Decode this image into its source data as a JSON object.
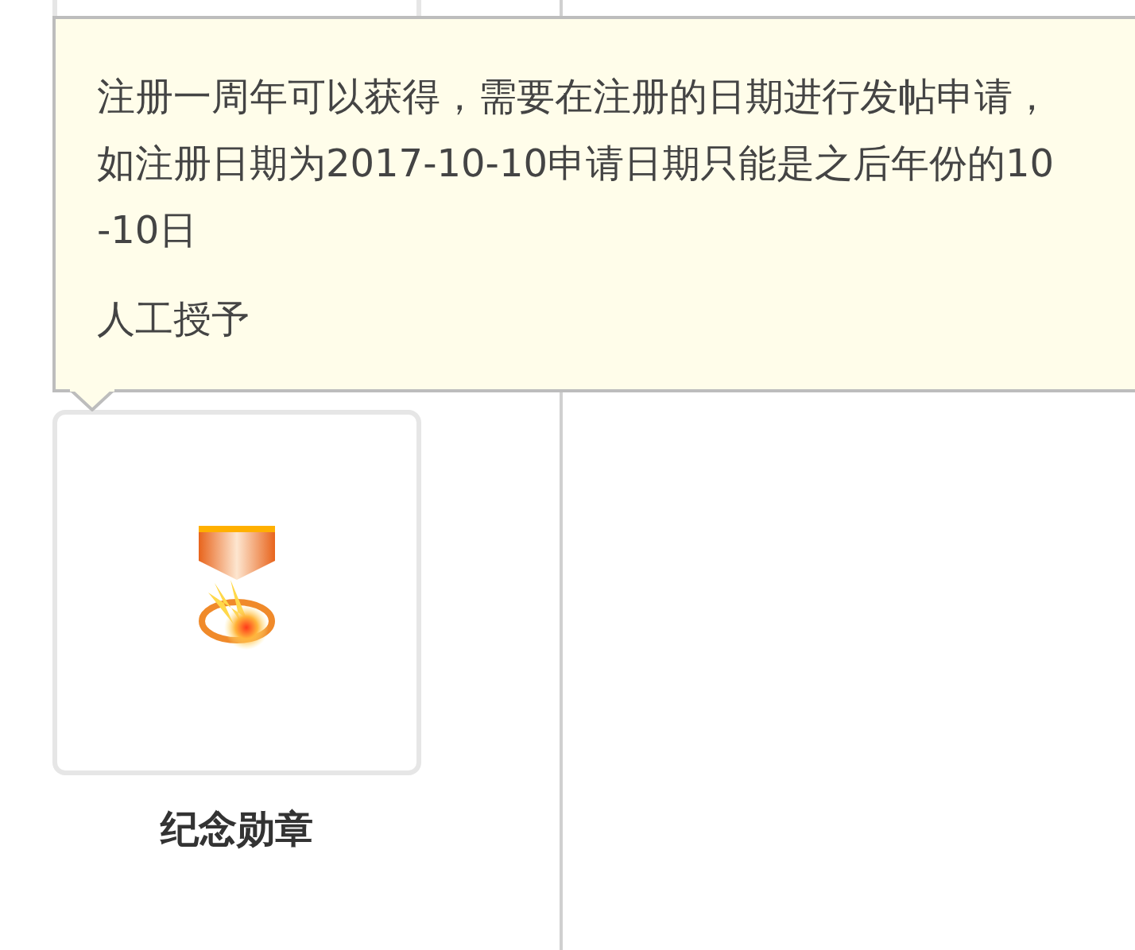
{
  "tooltip": {
    "description": "注册一周年可以获得，需要在注册的日期进行发帖申请，如注册日期为2017-10-10申请日期只能是之后年份的10-10日",
    "source": "人工授予"
  },
  "badges": [
    {
      "name": "纪念勋章"
    }
  ]
}
